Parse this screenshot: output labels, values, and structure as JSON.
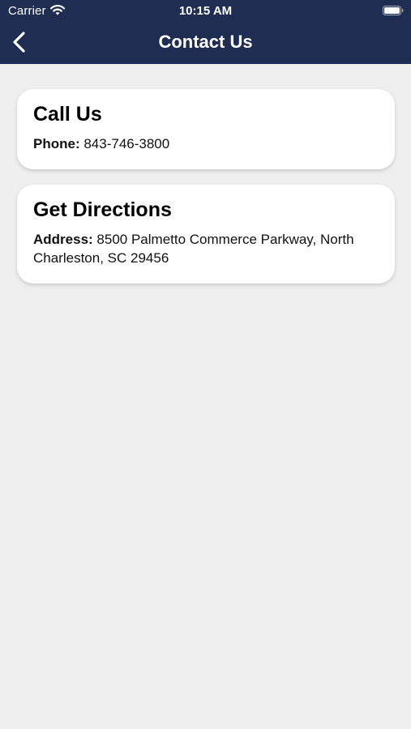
{
  "status_bar": {
    "carrier": "Carrier",
    "time": "10:15 AM"
  },
  "header": {
    "title": "Contact Us",
    "background": "#1f2d52"
  },
  "cards": {
    "call": {
      "title": "Call Us",
      "label": "Phone:",
      "value": "843-746-3800"
    },
    "directions": {
      "title": "Get Directions",
      "label": "Address:",
      "value": "8500 Palmetto Commerce Parkway, North Charleston, SC 29456"
    }
  },
  "icons": {
    "back": "chevron-left-icon",
    "wifi": "wifi-icon",
    "battery": "battery-icon"
  }
}
